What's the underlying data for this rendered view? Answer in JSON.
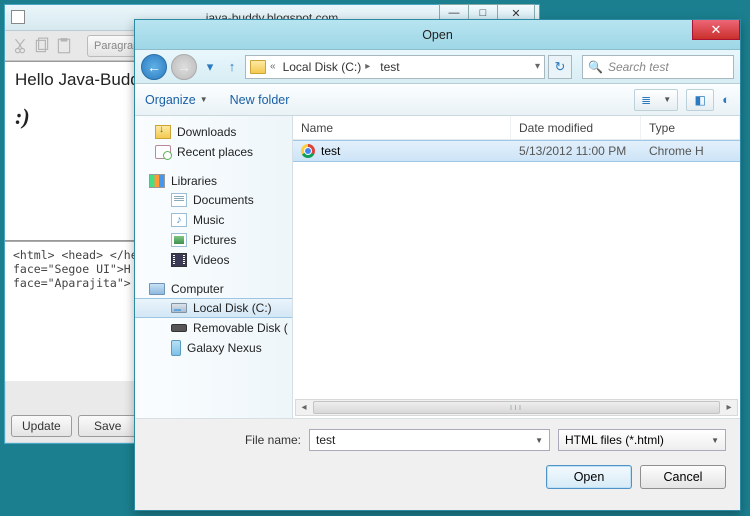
{
  "app": {
    "title": "java-buddy.blogspot.com",
    "toolbar_dropdown": "Paragraph",
    "content_heading": "Hello Java-Budd",
    "content_body": ":)",
    "source_text": "<html> <head> </he\nface=\"Segoe UI\">H\nface=\"Aparajita\"> <b",
    "btn_update": "Update",
    "btn_save": "Save"
  },
  "dialog": {
    "title": "Open",
    "breadcrumb": {
      "seg1": "Local Disk (C:)",
      "seg2": "test"
    },
    "search_placeholder": "Search test",
    "organize": "Organize",
    "new_folder": "New folder",
    "tree": {
      "downloads": "Downloads",
      "recent": "Recent places",
      "libraries": "Libraries",
      "documents": "Documents",
      "music": "Music",
      "pictures": "Pictures",
      "videos": "Videos",
      "computer": "Computer",
      "local_disk": "Local Disk (C:)",
      "removable": "Removable Disk (",
      "galaxy": "Galaxy Nexus"
    },
    "columns": {
      "name": "Name",
      "date": "Date modified",
      "type": "Type"
    },
    "files": [
      {
        "name": "test",
        "date": "5/13/2012 11:00 PM",
        "type": "Chrome H"
      }
    ],
    "scrollbar_grip": "ııı",
    "filename_label": "File name:",
    "filename_value": "test",
    "filter_value": "HTML files (*.html)",
    "btn_open": "Open",
    "btn_cancel": "Cancel"
  }
}
